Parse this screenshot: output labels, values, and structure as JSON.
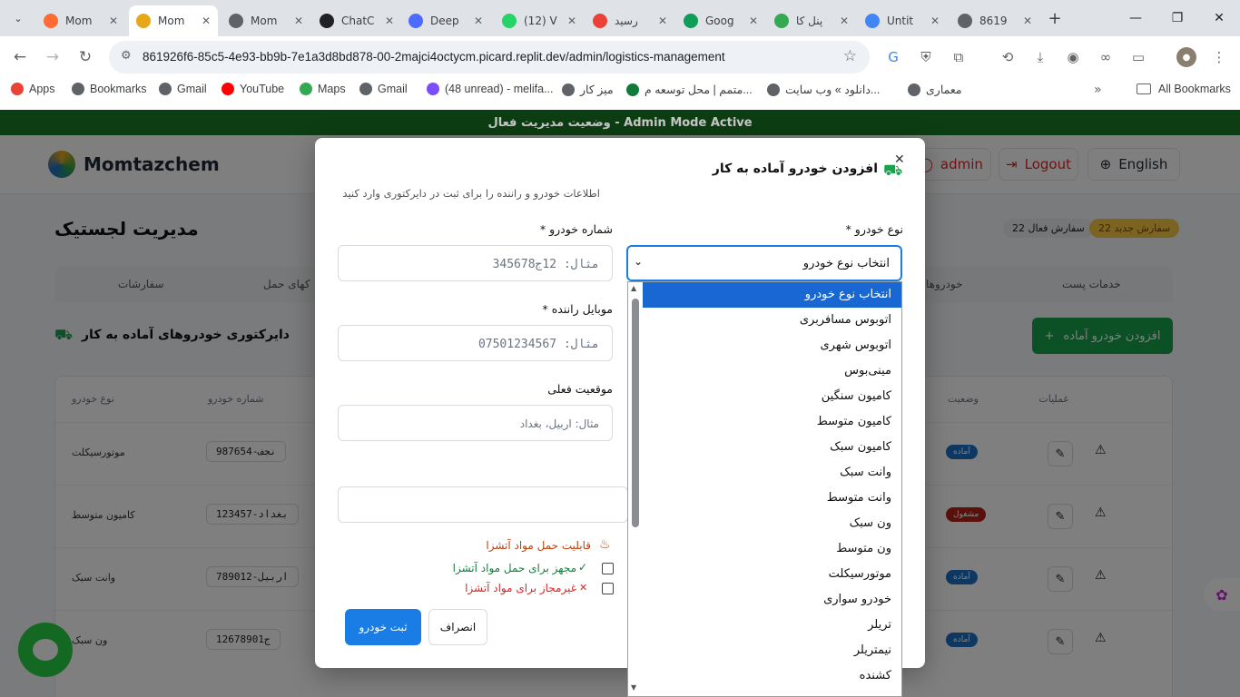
{
  "browser": {
    "tabs": [
      {
        "title": "Mom",
        "color": "#ff6b35"
      },
      {
        "title": "Mom",
        "color": "#e6a817",
        "active": true
      },
      {
        "title": "Mom",
        "color": "#5f6368"
      },
      {
        "title": "ChatC",
        "color": "#202124"
      },
      {
        "title": "Deep",
        "color": "#4d6bfe"
      },
      {
        "title": "(12) V",
        "color": "#25d366"
      },
      {
        "title": "رسید",
        "color": "#ea4335"
      },
      {
        "title": "Goog",
        "color": "#0f9d58"
      },
      {
        "title": "پنل کا",
        "color": "#34a853"
      },
      {
        "title": "Untit",
        "color": "#4285f4"
      },
      {
        "title": "8619",
        "color": "#5f6368"
      }
    ],
    "url": "861926f6-85c5-4e93-bb9b-7e1a3d8bd878-00-2majci4octycm.picard.replit.dev/admin/logistics-management",
    "bookmarks": [
      "Apps",
      "Bookmarks",
      "Gmail",
      "YouTube",
      "Maps",
      "Gmail",
      "(48 unread) - melifa...",
      "میز کار",
      "متمم | محل توسعه م...",
      "دانلود » وب سایت...",
      "معماری"
    ],
    "all_bookmarks": "All Bookmarks"
  },
  "site": {
    "banner": "وضعیت مدیریت فعال - Admin Mode Active",
    "brand": "Momtazchem",
    "admin_label": "admin",
    "logout_label": "Logout",
    "language_label": "English",
    "page_title": "مدیریت لجستیک",
    "stat_new": "سفارش جدید 22",
    "stat_active": "سفارش فعال 22",
    "tabs": [
      "خدمات پست",
      "خودروها",
      "کهای حمل",
      "سفارشات"
    ],
    "directory_title": "دایرکتوری خودروهای آماده به کار",
    "add_vehicle_button": "افزودن خودرو آماده",
    "table_headers": [
      "عملیات",
      "وضعیت",
      "شماره خودرو",
      "نوع خودرو"
    ],
    "rows": [
      {
        "type": "موتورسیکلت",
        "plate": "نجف-987654",
        "status": "آماده",
        "status_color": "#1d6fc2"
      },
      {
        "type": "کامیون متوسط",
        "plate": "بغداد-123457",
        "status": "مشغول",
        "status_color": "#b42318"
      },
      {
        "type": "وانت سبک",
        "plate": "اربیل-789012",
        "status": "آماده",
        "status_color": "#1d6fc2"
      },
      {
        "type": "ون سبک",
        "plate": "12678901ج",
        "status": "آماده",
        "status_color": "#1d6fc2"
      }
    ]
  },
  "modal": {
    "title": "افزودن خودرو آماده به کار",
    "subtitle": "اطلاعات خودرو و راننده را برای ثبت در دایرکتوری وارد کنید",
    "vehicle_type_label": "نوع خودرو *",
    "vehicle_type_value": "انتخاب نوع خودرو",
    "plate_label": "شماره خودرو *",
    "plate_placeholder": "مثال: 12ج345678",
    "mobile_label": "موبایل راننده *",
    "mobile_placeholder": "مثال: 07501234567",
    "location_label": "موقعیت فعلی",
    "location_placeholder": "مثال: اربیل، بغداد",
    "flammable_heading": "قابلیت حمل مواد آتشزا",
    "allowed_label": "مجهز برای حمل مواد آتشزا",
    "forbidden_label": "غیرمجاز برای مواد آتشزا",
    "submit_label": "ثبت خودرو",
    "cancel_label": "انصراف",
    "accent": "#1a7de6"
  },
  "dropdown_options": [
    "انتخاب نوع خودرو",
    "اتوبوس مسافربری",
    "اتوبوس شهری",
    "مینی‌بوس",
    "کامیون سنگین",
    "کامیون متوسط",
    "کامیون سبک",
    "وانت سبک",
    "وانت متوسط",
    "ون سبک",
    "ون متوسط",
    "موتورسیکلت",
    "خودرو سواری",
    "تریلر",
    "نیمتریلر",
    "کشنده"
  ]
}
